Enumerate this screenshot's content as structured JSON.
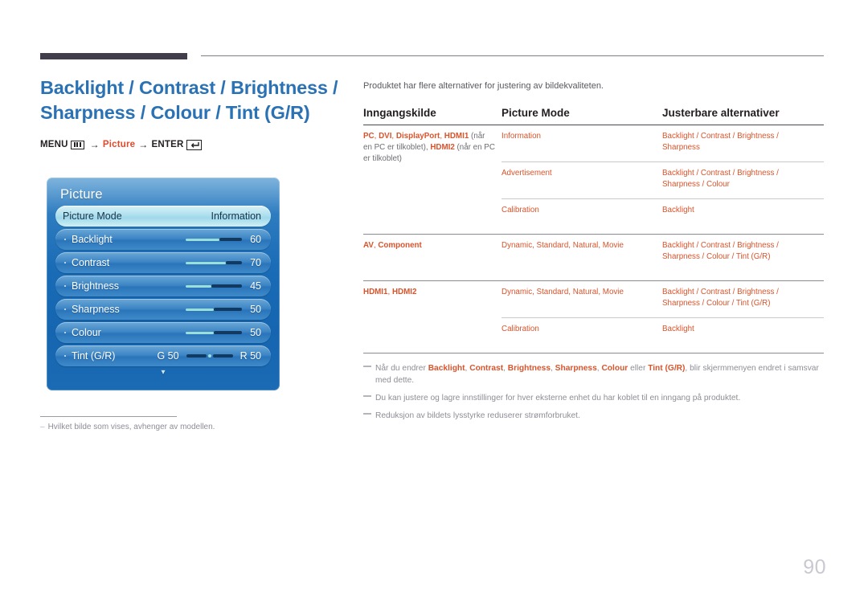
{
  "header": {
    "title": "Backlight / Contrast / Brightness / Sharpness / Colour / Tint (G/R)",
    "menu_path": {
      "menu_label": "MENU",
      "menu_icon": "menu-bars-icon",
      "arrow": "→",
      "picture_label": "Picture",
      "enter_label": "ENTER",
      "enter_icon": "enter-return-icon"
    }
  },
  "osd": {
    "title": "Picture",
    "rows": [
      {
        "label": "Picture Mode",
        "value": "Information",
        "type": "selected"
      },
      {
        "label": "Backlight",
        "value": "60",
        "type": "slider",
        "fill_percent": 60
      },
      {
        "label": "Contrast",
        "value": "70",
        "type": "slider",
        "fill_percent": 70
      },
      {
        "label": "Brightness",
        "value": "45",
        "type": "slider",
        "fill_percent": 45
      },
      {
        "label": "Sharpness",
        "value": "50",
        "type": "slider",
        "fill_percent": 50
      },
      {
        "label": "Colour",
        "value": "50",
        "type": "slider",
        "fill_percent": 50
      },
      {
        "label": "Tint (G/R)",
        "left_value": "G 50",
        "right_value": "R 50",
        "type": "tint"
      }
    ],
    "scroll_arrow": "▾"
  },
  "left_note": {
    "dash": "–",
    "text": "Hvilket bilde som vises, avhenger av modellen."
  },
  "main": {
    "intro": "Produktet har flere alternativer for justering av bildekvaliteten.",
    "table": {
      "headers": [
        "Inngangskilde",
        "Picture Mode",
        "Justerbare alternativer"
      ],
      "rows": [
        {
          "source_parts": [
            {
              "t": "PC",
              "s": "b"
            },
            {
              "t": ", ",
              "s": "sep"
            },
            {
              "t": "DVI",
              "s": "b"
            },
            {
              "t": ", ",
              "s": "sep"
            },
            {
              "t": "DisplayPort",
              "s": "b"
            },
            {
              "t": ", ",
              "s": "sep"
            },
            {
              "t": "HDMI1",
              "s": "b"
            },
            {
              "t": " (når en PC er tilkoblet), ",
              "s": "gray"
            },
            {
              "t": "HDMI2",
              "s": "b"
            },
            {
              "t": " (når en PC er tilkoblet)",
              "s": "gray"
            }
          ],
          "subrows": [
            {
              "mode": "Information",
              "options": "Backlight / Contrast / Brightness / Sharpness"
            },
            {
              "mode": "Advertisement",
              "options": "Backlight / Contrast / Brightness / Sharpness / Colour"
            },
            {
              "mode": "Calibration",
              "options": "Backlight"
            }
          ]
        },
        {
          "source_parts": [
            {
              "t": "AV",
              "s": "b"
            },
            {
              "t": ", ",
              "s": "sep"
            },
            {
              "t": "Component",
              "s": "b"
            }
          ],
          "subrows": [
            {
              "mode": "Dynamic, Standard, Natural, Movie",
              "options": "Backlight / Contrast / Brightness / Sharpness / Colour / Tint (G/R)"
            }
          ]
        },
        {
          "source_parts": [
            {
              "t": "HDMI1",
              "s": "b"
            },
            {
              "t": ", ",
              "s": "sep"
            },
            {
              "t": "HDMI2",
              "s": "b"
            }
          ],
          "subrows": [
            {
              "mode": "Dynamic, Standard, Natural, Movie",
              "options": "Backlight / Contrast / Brightness / Sharpness / Colour / Tint (G/R)"
            },
            {
              "mode": "Calibration",
              "options": "Backlight"
            }
          ]
        }
      ]
    },
    "notes": [
      {
        "parts": [
          {
            "t": "Når du endrer ",
            "s": "plain"
          },
          {
            "t": "Backlight",
            "s": "term"
          },
          {
            "t": ", ",
            "s": "plain"
          },
          {
            "t": "Contrast",
            "s": "term"
          },
          {
            "t": ", ",
            "s": "plain"
          },
          {
            "t": "Brightness",
            "s": "term"
          },
          {
            "t": ", ",
            "s": "plain"
          },
          {
            "t": "Sharpness",
            "s": "term"
          },
          {
            "t": ", ",
            "s": "plain"
          },
          {
            "t": "Colour",
            "s": "term"
          },
          {
            "t": "  eller ",
            "s": "plain"
          },
          {
            "t": "Tint (G/R)",
            "s": "term"
          },
          {
            "t": ", blir skjermmenyen endret i samsvar med dette.",
            "s": "plain"
          }
        ]
      },
      {
        "parts": [
          {
            "t": "Du kan justere og lagre innstillinger for hver eksterne enhet du har koblet til en inngang på produktet.",
            "s": "plain"
          }
        ]
      },
      {
        "parts": [
          {
            "t": "Reduksjon av bildets lysstyrke reduserer strømforbruket.",
            "s": "plain"
          }
        ]
      }
    ]
  },
  "page_number": "90",
  "colors": {
    "title_blue": "#2a72b4",
    "accent_orange": "#d8542c",
    "osd_blue": "#1565b0",
    "slider_fill": "#9ae0d9",
    "slider_track": "#123a60",
    "muted_gray": "#8d8d96",
    "rule_dark": "#413d4a"
  }
}
